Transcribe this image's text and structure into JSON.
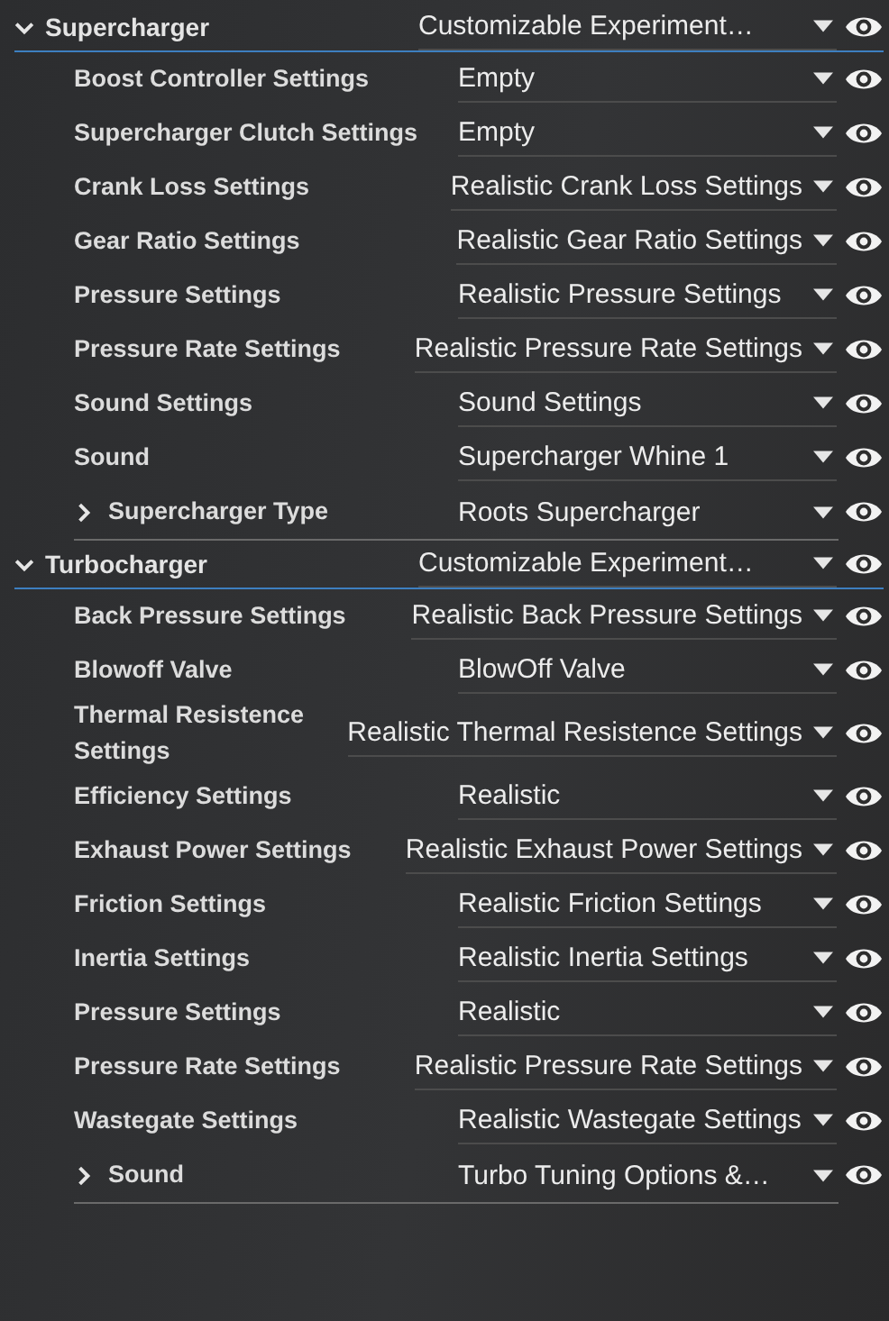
{
  "groups": [
    {
      "label": "Supercharger",
      "expanded": true,
      "value": "Customizable Experiment…",
      "items": [
        {
          "label": "Boost Controller Settings",
          "value": "Empty",
          "kind": "setting"
        },
        {
          "label": "Supercharger Clutch Settings",
          "value": "Empty",
          "kind": "setting"
        },
        {
          "label": "Crank Loss Settings",
          "value": "Realistic Crank Loss Settings",
          "kind": "setting"
        },
        {
          "label": "Gear Ratio Settings",
          "value": "Realistic Gear Ratio Settings",
          "kind": "setting"
        },
        {
          "label": "Pressure Settings",
          "value": "Realistic Pressure Settings",
          "kind": "setting"
        },
        {
          "label": "Pressure Rate Settings",
          "value": "Realistic Pressure Rate Settings",
          "kind": "setting"
        },
        {
          "label": "Sound Settings",
          "value": "Sound Settings",
          "kind": "setting"
        },
        {
          "label": "Sound",
          "value": "Supercharger Whine 1",
          "kind": "setting"
        },
        {
          "label": "Supercharger Type",
          "value": "Roots Supercharger",
          "kind": "subgroup",
          "expanded": false
        }
      ]
    },
    {
      "label": "Turbocharger",
      "expanded": true,
      "value": "Customizable Experiment…",
      "items": [
        {
          "label": "Back Pressure Settings",
          "value": "Realistic Back Pressure Settings",
          "kind": "setting"
        },
        {
          "label": "Blowoff Valve",
          "value": "BlowOff Valve",
          "kind": "setting"
        },
        {
          "label": "Thermal Resistence Settings",
          "value": "Realistic Thermal Resistence Settings",
          "kind": "setting"
        },
        {
          "label": "Efficiency Settings",
          "value": "Realistic",
          "kind": "setting"
        },
        {
          "label": "Exhaust Power Settings",
          "value": "Realistic Exhaust Power Settings",
          "kind": "setting"
        },
        {
          "label": "Friction Settings",
          "value": "Realistic Friction Settings",
          "kind": "setting"
        },
        {
          "label": "Inertia Settings",
          "value": "Realistic Inertia Settings",
          "kind": "setting"
        },
        {
          "label": "Pressure Settings",
          "value": "Realistic",
          "kind": "setting"
        },
        {
          "label": "Pressure Rate Settings",
          "value": "Realistic Pressure Rate Settings",
          "kind": "setting"
        },
        {
          "label": "Wastegate Settings",
          "value": "Realistic Wastegate Settings",
          "kind": "setting"
        },
        {
          "label": "Sound",
          "value": "Turbo Tuning Options &…",
          "kind": "subgroup",
          "expanded": false
        }
      ]
    }
  ]
}
